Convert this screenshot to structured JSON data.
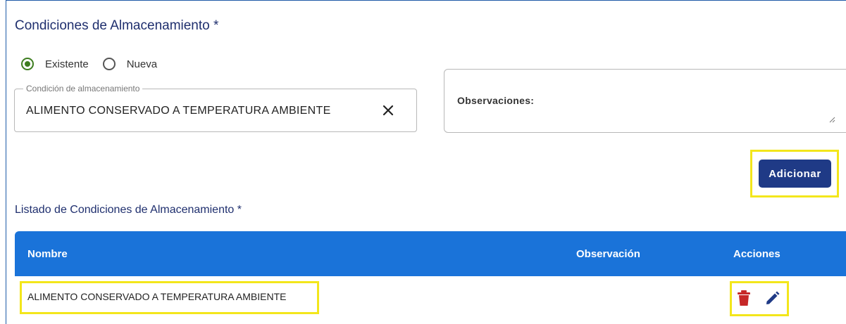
{
  "section": {
    "title": "Condiciones de Almacenamiento *"
  },
  "radios": [
    {
      "label": "Existente",
      "checked": true
    },
    {
      "label": "Nueva",
      "checked": false
    }
  ],
  "condition_field": {
    "legend": "Condición de almacenamiento",
    "value": "ALIMENTO CONSERVADO A TEMPERATURA AMBIENTE",
    "clear_icon": "close-icon"
  },
  "observations": {
    "label": "Observaciones:",
    "value": ""
  },
  "add_button": {
    "label": "Adicionar"
  },
  "list": {
    "title": "Listado de Condiciones de Almacenamiento *",
    "columns": [
      "Nombre",
      "Observación",
      "Acciones"
    ],
    "rows": [
      {
        "nombre": "ALIMENTO CONSERVADO A TEMPERATURA AMBIENTE",
        "observacion": "",
        "actions": [
          "delete-icon",
          "edit-icon"
        ]
      }
    ]
  },
  "colors": {
    "header": "#1a73d9",
    "button": "#1f3a86",
    "highlight": "#f3e61b",
    "delete": "#c62828",
    "edit": "#1f3a86",
    "radio_checked": "#3d7d1f"
  }
}
